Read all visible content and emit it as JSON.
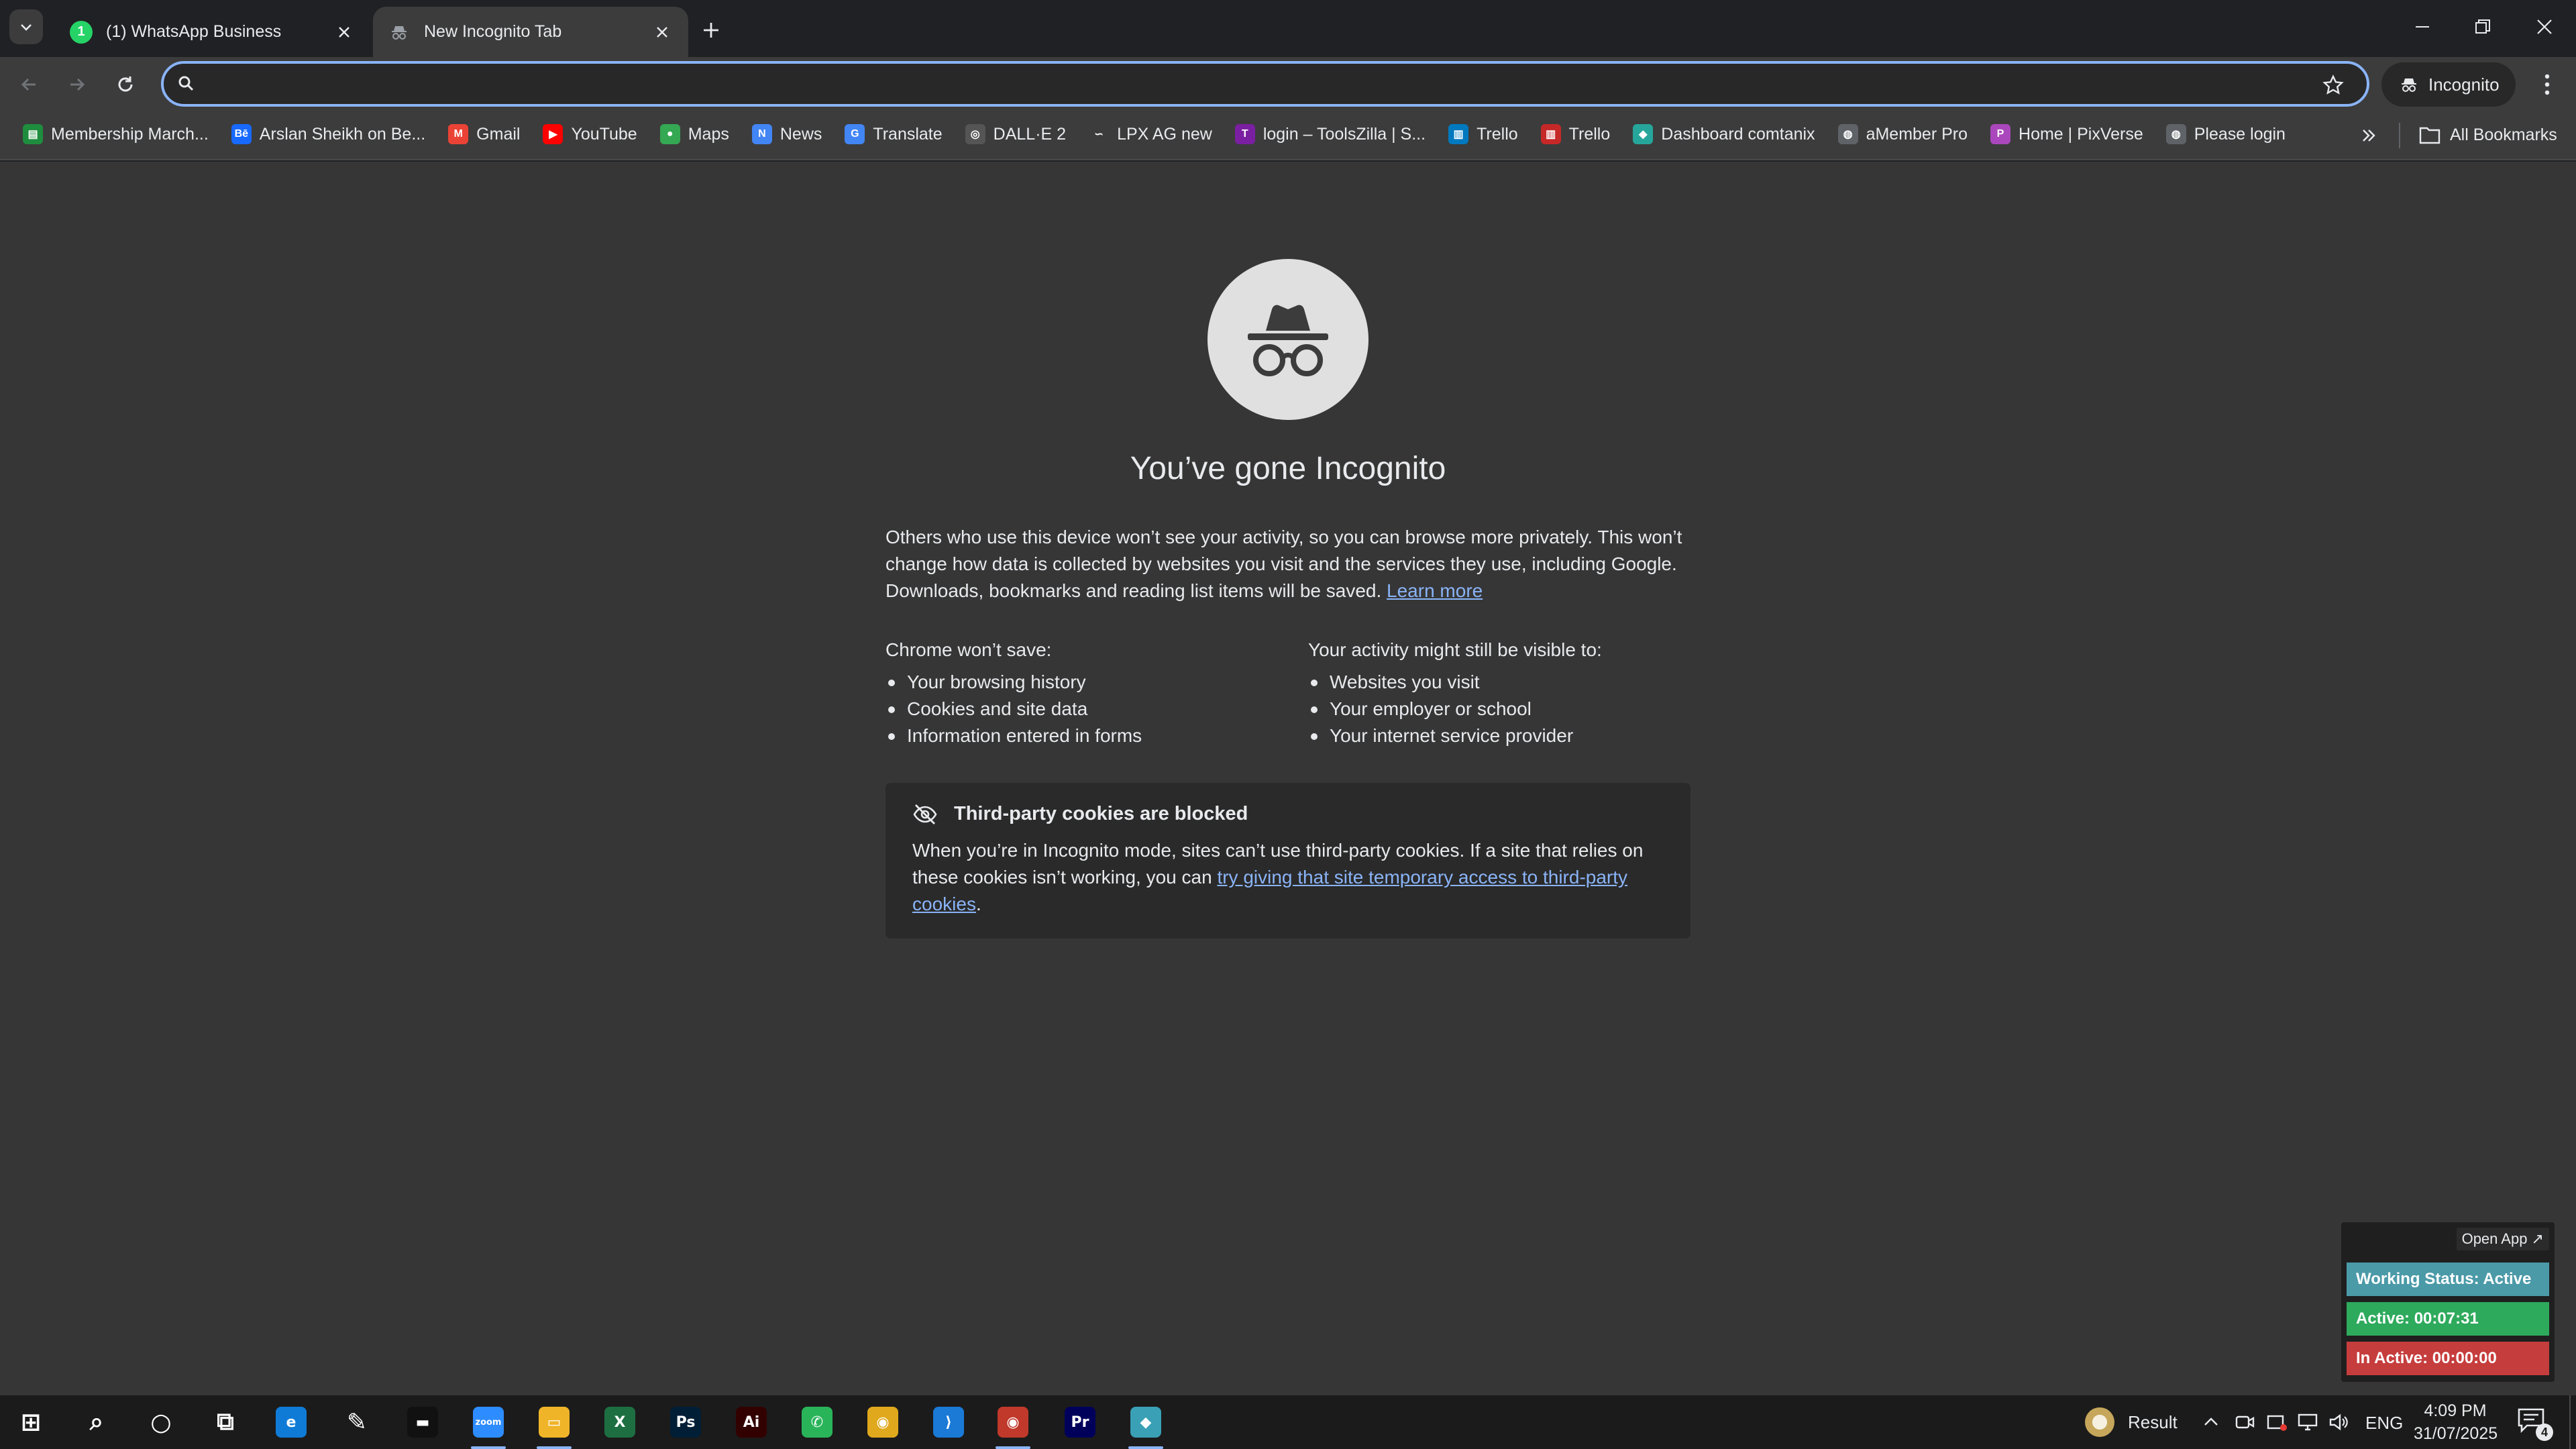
{
  "tabs": [
    {
      "title": "(1) WhatsApp Business",
      "icon": "whatsapp-icon",
      "color": "#25d366",
      "badge": "1"
    },
    {
      "title": "New Incognito Tab",
      "icon": "incognito-icon",
      "color": "#9aa0a6"
    }
  ],
  "toolbar": {
    "omnibox_value": "",
    "profile_label": "Incognito"
  },
  "bookmarks": [
    {
      "label": "Membership March...",
      "icon": "membership-icon",
      "color": "#1e8e3e",
      "glyph": "▤"
    },
    {
      "label": "Arslan Sheikh on Be...",
      "icon": "behance-icon",
      "color": "#1769ff",
      "glyph": "Bē"
    },
    {
      "label": "Gmail",
      "icon": "gmail-icon",
      "color": "#ea4335",
      "glyph": "M"
    },
    {
      "label": "YouTube",
      "icon": "youtube-icon",
      "color": "#ff0000",
      "glyph": "▶"
    },
    {
      "label": "Maps",
      "icon": "maps-icon",
      "color": "#34a853",
      "glyph": "●"
    },
    {
      "label": "News",
      "icon": "news-icon",
      "color": "#4285f4",
      "glyph": "N"
    },
    {
      "label": "Translate",
      "icon": "translate-icon",
      "color": "#4285f4",
      "glyph": "G"
    },
    {
      "label": "DALL·E 2",
      "icon": "dalle-icon",
      "color": "#555555",
      "glyph": "◎"
    },
    {
      "label": "LPX AG new",
      "icon": "lpx-icon",
      "color": "#3c3c3c",
      "glyph": "∽"
    },
    {
      "label": "login – ToolsZilla | S...",
      "icon": "toolszilla-icon",
      "color": "#7b1fa2",
      "glyph": "T"
    },
    {
      "label": "Trello",
      "icon": "trello-icon",
      "color": "#0079bf",
      "glyph": "▥"
    },
    {
      "label": "Trello",
      "icon": "trello-red-icon",
      "color": "#c62828",
      "glyph": "▥"
    },
    {
      "label": "Dashboard comtanix",
      "icon": "comtanix-icon",
      "color": "#26a69a",
      "glyph": "◆"
    },
    {
      "label": "aMember Pro",
      "icon": "globe-icon",
      "color": "#5f6368",
      "glyph": "◍"
    },
    {
      "label": "Home | PixVerse",
      "icon": "pixverse-icon",
      "color": "#ab47bc",
      "glyph": "P"
    },
    {
      "label": "Please login",
      "icon": "globe-icon",
      "color": "#5f6368",
      "glyph": "◍"
    }
  ],
  "all_bookmarks_label": "All Bookmarks",
  "page": {
    "headline": "You’ve gone Incognito",
    "intro": "Others who use this device won’t see your activity, so you can browse more privately. This won’t change how data is collected by websites you visit and the services they use, including Google. Downloads, bookmarks and reading list items will be saved.",
    "learn_more": "Learn more",
    "wont_save_title": "Chrome won’t save:",
    "wont_save": [
      "Your browsing history",
      "Cookies and site data",
      "Information entered in forms"
    ],
    "visible_title": "Your activity might still be visible to:",
    "visible": [
      "Websites you visit",
      "Your employer or school",
      "Your internet service provider"
    ],
    "cookie_title": "Third-party cookies are blocked",
    "cookie_text": "When you’re in Incognito mode, sites can’t use third-party cookies. If a site that relies on these cookies isn’t working, you can ",
    "cookie_link": "try giving that site temporary access to third-party cookies",
    "cookie_end": "."
  },
  "widget": {
    "open_app": "Open App ↗",
    "working_status": "Working Status: Active",
    "active": "Active: 00:07:31",
    "inactive": "In Active: 00:00:00",
    "colors": {
      "status": "#4b9aa8",
      "active": "#2eaa5c",
      "inactive": "#c63d3d"
    }
  },
  "taskbar": {
    "apps": [
      {
        "name": "start-icon",
        "glyph": "⊞",
        "color": "transparent"
      },
      {
        "name": "search-icon",
        "glyph": "⌕",
        "color": "transparent"
      },
      {
        "name": "cortana-icon",
        "glyph": "○",
        "color": "transparent"
      },
      {
        "name": "task-view-icon",
        "glyph": "⧉",
        "color": "transparent"
      },
      {
        "name": "edge-icon",
        "glyph": "e",
        "color": "#0f7bd6"
      },
      {
        "name": "pen-icon",
        "glyph": "✎",
        "color": "transparent"
      },
      {
        "name": "terminal-icon",
        "glyph": "▬",
        "color": "#111111"
      },
      {
        "name": "zoom-icon",
        "glyph": "zoom",
        "color": "#2d8cff"
      },
      {
        "name": "file-explorer-icon",
        "glyph": "▭",
        "color": "#f0b429"
      },
      {
        "name": "excel-icon",
        "glyph": "X",
        "color": "#1d6f42"
      },
      {
        "name": "photoshop-icon",
        "glyph": "Ps",
        "color": "#001e36"
      },
      {
        "name": "illustrator-icon",
        "glyph": "Ai",
        "color": "#330000"
      },
      {
        "name": "whatsapp-task-icon",
        "glyph": "✆",
        "color": "#2ab45a"
      },
      {
        "name": "chrome-icon",
        "glyph": "◉",
        "color": "#e0a81c"
      },
      {
        "name": "vscode-icon",
        "glyph": "⟩",
        "color": "#1a7ad6"
      },
      {
        "name": "chrome-incognito-icon",
        "glyph": "◉",
        "color": "#c0392b"
      },
      {
        "name": "premiere-icon",
        "glyph": "Pr",
        "color": "#00005b"
      },
      {
        "name": "timetracker-icon",
        "glyph": "◆",
        "color": "#3aa0b5"
      }
    ],
    "result_label": "Result",
    "language": "ENG",
    "time": "4:09 PM",
    "date": "31/07/2025",
    "notifications": "4"
  }
}
